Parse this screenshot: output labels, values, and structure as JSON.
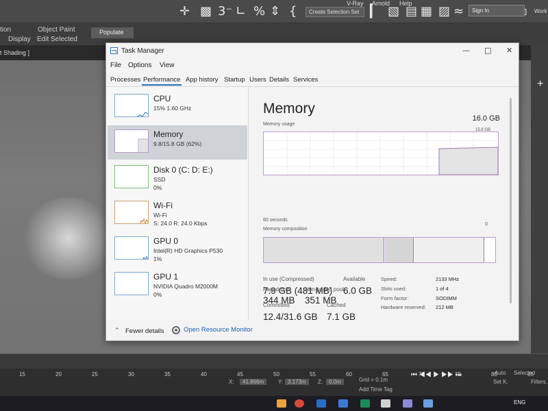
{
  "background_app": {
    "menus": [
      "V-Ray",
      "Arnold",
      "Help"
    ],
    "selection_set_placeholder": "Create Selection Set",
    "sign_in": "Sign In",
    "workspace": "Work",
    "ribbon_items": [
      "tion",
      "Object Paint",
      "Populate",
      "Display",
      "Edit Selected"
    ],
    "shading": "t Shading ]",
    "timeline_ticks": [
      "15",
      "20",
      "25",
      "30",
      "35",
      "40",
      "45",
      "50",
      "55",
      "60",
      "65",
      "70",
      "75",
      "80",
      "85"
    ],
    "status": {
      "x_label": "X:",
      "x_value": "41.866m",
      "y_label": "Y:",
      "y_value": "3.173m",
      "z_label": "Z:",
      "z_value": "0.0m",
      "grid": "Grid = 0.1m",
      "add_time_tag": "Add Time Tag",
      "auto": "Auto",
      "selected": "Selected",
      "set_k": "Set K.",
      "filters": "Filters..."
    },
    "taskbar_lang": "ENG"
  },
  "task_manager": {
    "title": "Task Manager",
    "window_controls": {
      "minimize": "—",
      "maximize": "□",
      "close": "✕"
    },
    "menu": [
      "File",
      "Options",
      "View"
    ],
    "tabs": [
      "Processes",
      "Performance",
      "App history",
      "Startup",
      "Users",
      "Details",
      "Services"
    ],
    "active_tab": "Performance",
    "resources": [
      {
        "name": "CPU",
        "line1": "15%  1.60 GHz",
        "line2": ""
      },
      {
        "name": "Memory",
        "line1": "9.8/15.8 GB (62%)",
        "line2": ""
      },
      {
        "name": "Disk 0 (C: D: E:)",
        "line1": "SSD",
        "line2": "0%"
      },
      {
        "name": "Wi-Fi",
        "line1": "Wi-Fi",
        "line2": "S: 24.0  R: 24.0 Kbps"
      },
      {
        "name": "GPU 0",
        "line1": "Intel(R) HD Graphics P530",
        "line2": "1%"
      },
      {
        "name": "GPU 1",
        "line1": "NVIDIA Quadro M2000M",
        "line2": "0%"
      }
    ],
    "selected_resource": "Memory",
    "footer": {
      "fewer_details": "Fewer details",
      "open_monitor": "Open Resource Monitor"
    },
    "memory": {
      "title": "Memory",
      "total": "16.0 GB",
      "usage_label": "Memory usage",
      "usage_max": "15.8 GB",
      "time_label": "60 seconds",
      "zero_label": "0",
      "composition_label": "Memory composition",
      "in_use_fraction": 0.62,
      "stats": {
        "in_use_label": "In use (Compressed)",
        "in_use_value": "7.9 GB (481 MB)",
        "available_label": "Available",
        "available_value": "6.0 GB",
        "committed_label": "Committed",
        "committed_value": "12.4/31.6 GB",
        "cached_label": "Cached",
        "cached_value": "7.1 GB",
        "paged_label": "Paged pool",
        "paged_value": "344 MB",
        "nonpaged_label": "Non-paged pool",
        "nonpaged_value": "351 MB"
      },
      "specs": [
        {
          "label": "Speed:",
          "value": "2133 MHz"
        },
        {
          "label": "Slots used:",
          "value": "1 of 4"
        },
        {
          "label": "Form factor:",
          "value": "SODIMM"
        },
        {
          "label": "Hardware reserved:",
          "value": "212 MB"
        }
      ]
    }
  },
  "colors": {
    "accent": "#2a6ebb",
    "memory_graph_border": "#b89cc8",
    "memory_fill": "#e4e4e4",
    "selected_row": "#cfd3d8"
  }
}
